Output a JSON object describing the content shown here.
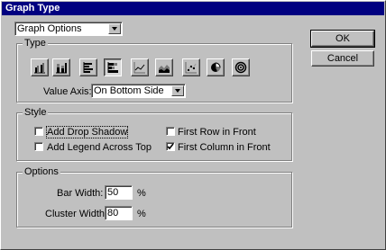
{
  "window": {
    "title": "Graph Type"
  },
  "view_select": {
    "value": "Graph Options"
  },
  "buttons": {
    "ok": "OK",
    "cancel": "Cancel"
  },
  "type_group": {
    "label": "Type",
    "graph_types": [
      {
        "icon": "grouped-column-icon",
        "selected": false
      },
      {
        "icon": "stacked-column-icon",
        "selected": false
      },
      {
        "icon": "grouped-bar-icon",
        "selected": false
      },
      {
        "icon": "stacked-bar-icon",
        "selected": true
      },
      {
        "icon": "line-graph-icon",
        "selected": false
      },
      {
        "icon": "area-graph-icon",
        "selected": false
      },
      {
        "icon": "scatter-graph-icon",
        "selected": false
      },
      {
        "icon": "pie-graph-icon",
        "selected": false
      },
      {
        "icon": "radar-graph-icon",
        "selected": false
      }
    ],
    "value_axis_label": "Value Axis:",
    "value_axis_value": "On Bottom Side"
  },
  "style_group": {
    "label": "Style",
    "add_drop_shadow": {
      "label": "Add Drop Shadow",
      "checked": false
    },
    "add_legend_across_top": {
      "label": "Add Legend Across Top",
      "checked": false
    },
    "first_row_in_front": {
      "label": "First Row in Front",
      "checked": false
    },
    "first_column_in_front": {
      "label": "First Column in Front",
      "checked": true
    }
  },
  "options_group": {
    "label": "Options",
    "bar_width_label": "Bar Width:",
    "bar_width_value": "50",
    "cluster_width_label": "Cluster Width:",
    "cluster_width_value": "80",
    "percent_unit": "%"
  },
  "colors": {
    "titlebar": "#000080",
    "face": "#c0c0c0"
  }
}
